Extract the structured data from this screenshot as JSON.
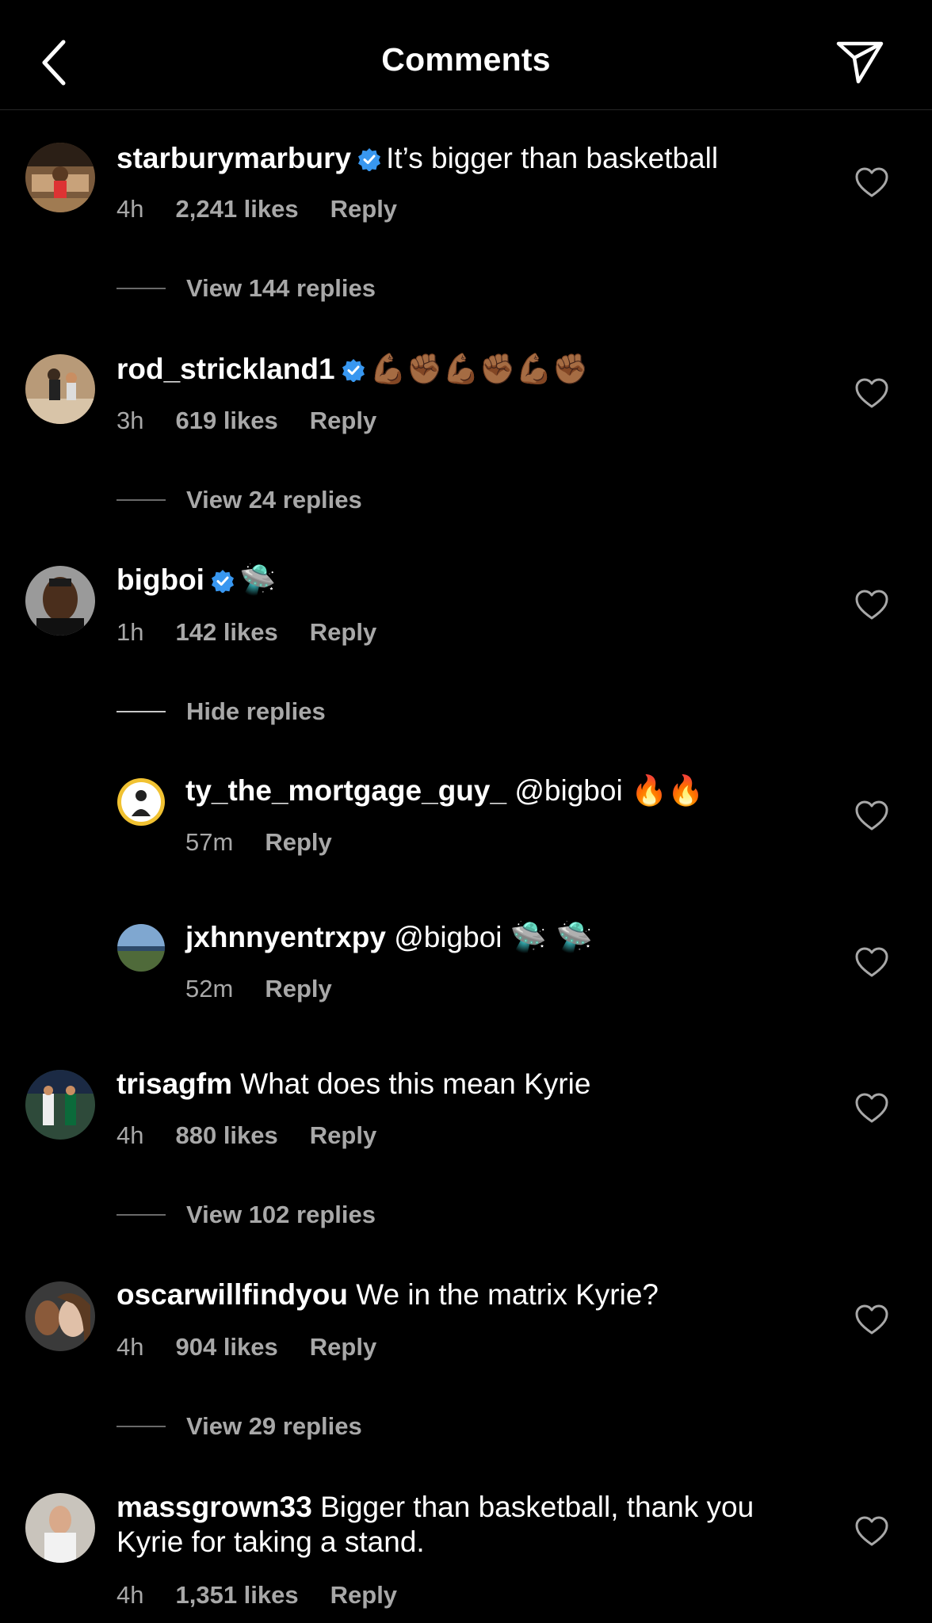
{
  "header": {
    "title": "Comments"
  },
  "comments": [
    {
      "username": "starburymarbury",
      "verified": true,
      "text": "It’s bigger than basketball",
      "time": "4h",
      "likes": "2,241 likes",
      "reply": "Reply",
      "replies_toggle": "View 144 replies"
    },
    {
      "username": "rod_strickland1",
      "verified": true,
      "text": "💪🏾✊🏾💪🏾✊🏾💪🏾✊🏾",
      "time": "3h",
      "likes": "619 likes",
      "reply": "Reply",
      "replies_toggle": "View 24 replies"
    },
    {
      "username": "bigboi",
      "verified": true,
      "text": "🛸",
      "time": "1h",
      "likes": "142 likes",
      "reply": "Reply",
      "replies_toggle": "Hide replies",
      "replies": [
        {
          "username": "ty_the_mortgage_guy_",
          "mention": "@bigboi",
          "text": "🔥🔥",
          "time": "57m",
          "reply": "Reply"
        },
        {
          "username": "jxhnnyentrxpy",
          "mention": "@bigboi",
          "text": "🛸 🛸",
          "time": "52m",
          "reply": "Reply"
        }
      ]
    },
    {
      "username": "trisagfm",
      "verified": false,
      "text": "What does this mean Kyrie",
      "time": "4h",
      "likes": "880 likes",
      "reply": "Reply",
      "replies_toggle": "View 102 replies"
    },
    {
      "username": "oscarwillfindyou",
      "verified": false,
      "text": "We in the matrix Kyrie?",
      "time": "4h",
      "likes": "904 likes",
      "reply": "Reply",
      "replies_toggle": "View 29 replies"
    },
    {
      "username": "massgrown33",
      "verified": false,
      "text": "Bigger than basketball, thank you Kyrie for taking a stand.",
      "time": "4h",
      "likes": "1,351 likes",
      "reply": "Reply"
    }
  ],
  "colors": {
    "background": "#000000",
    "secondary_text": "#a8a8a8",
    "verified": "#3897f0",
    "divider": "#262626"
  },
  "icons": {
    "back": "chevron-left-icon",
    "share": "paper-plane-icon",
    "like": "heart-outline-icon",
    "verified": "verified-badge-icon"
  }
}
